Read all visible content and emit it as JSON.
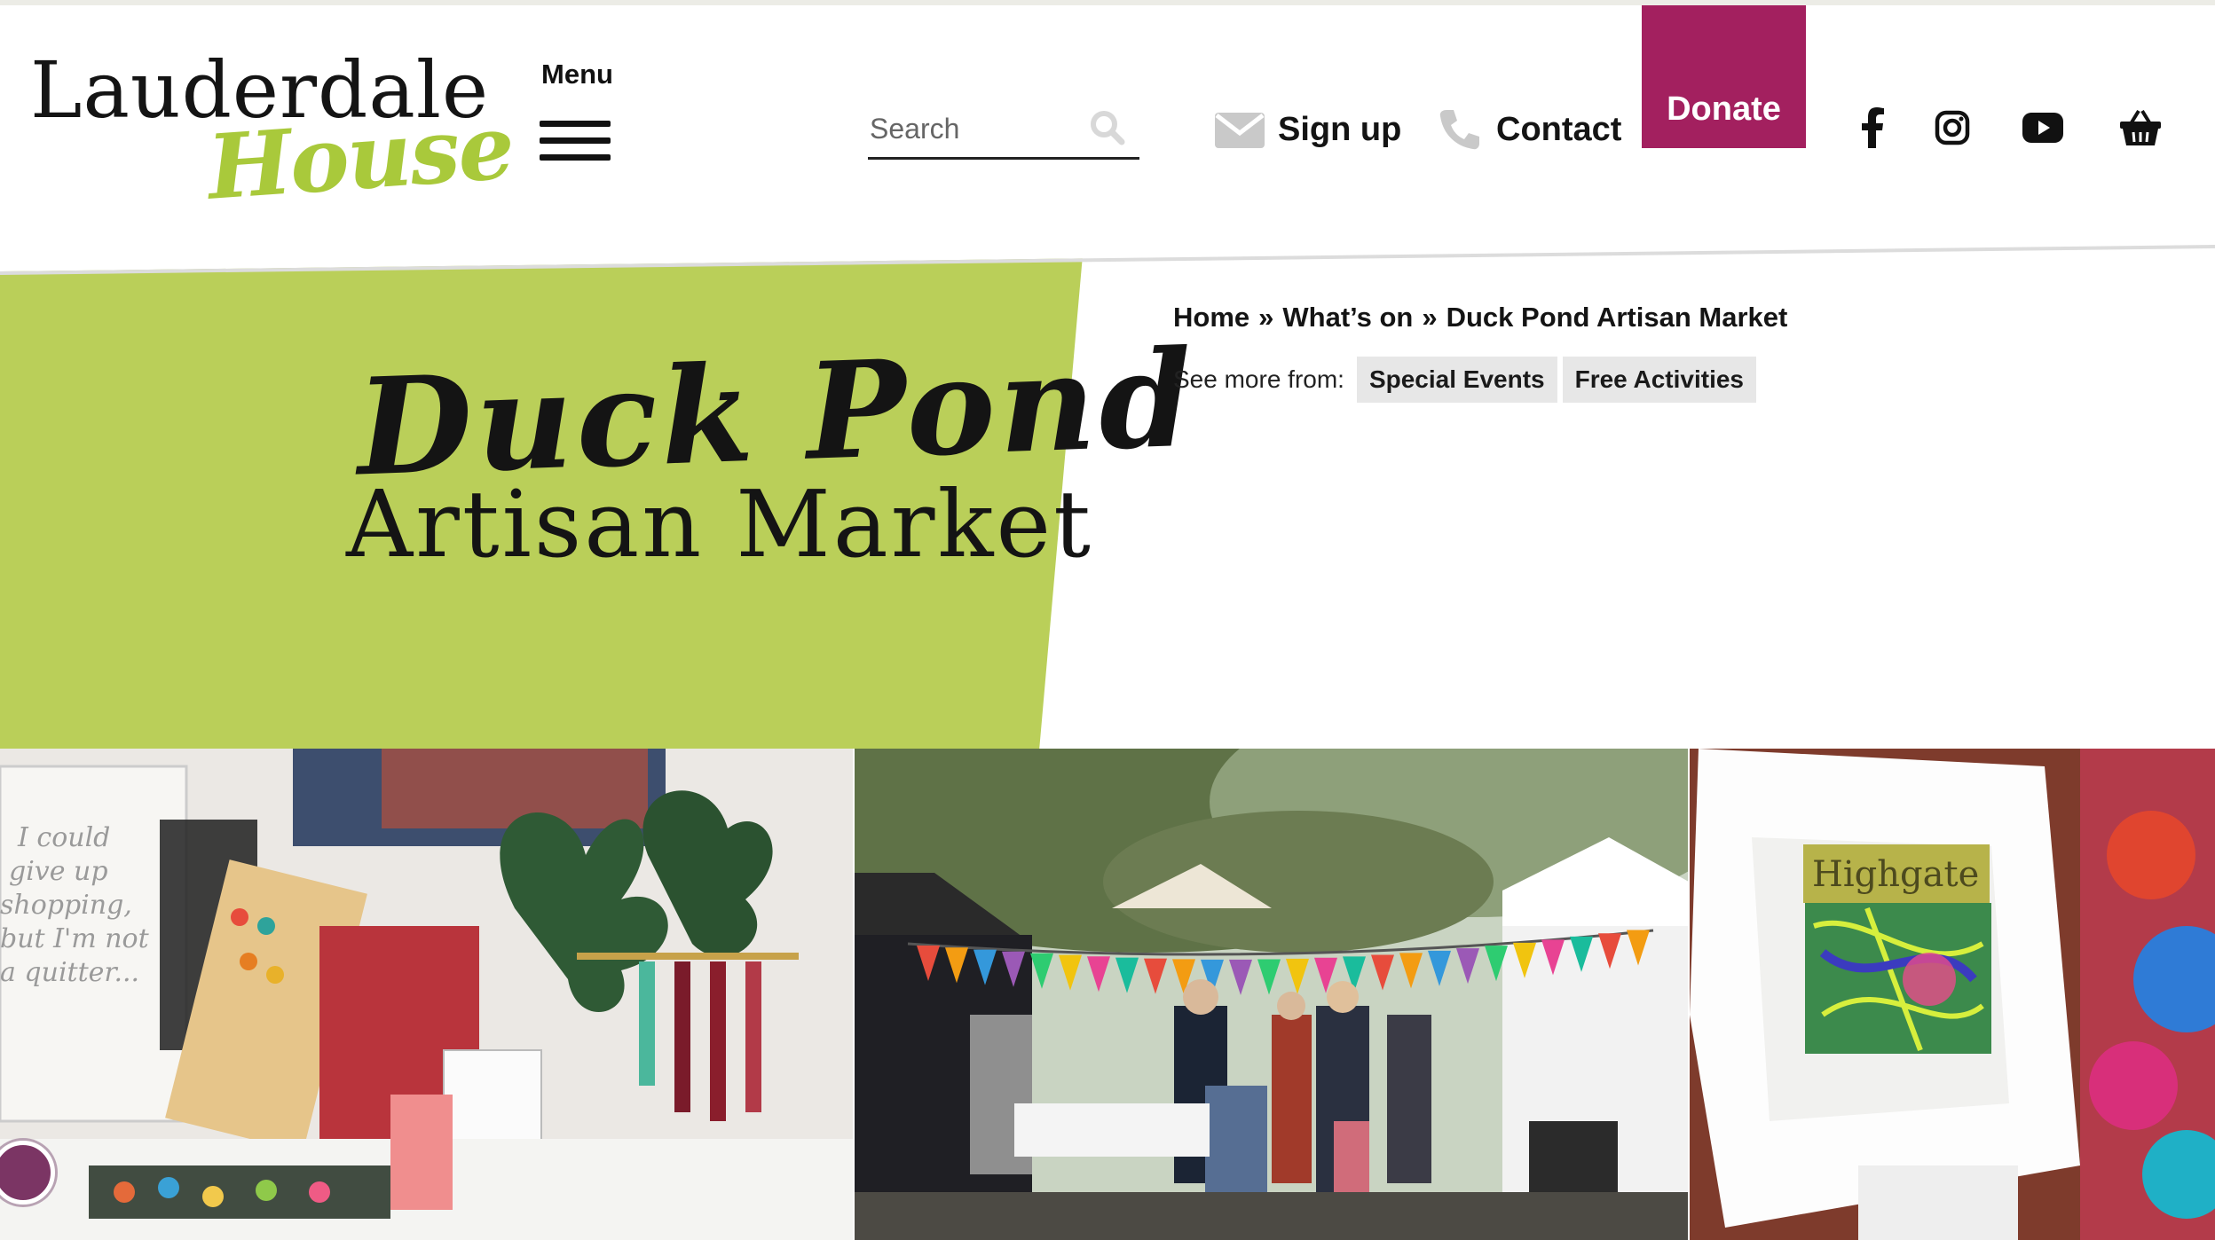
{
  "logo": {
    "line1": "Lauderdale",
    "line2": "House"
  },
  "menu": {
    "label": "Menu"
  },
  "search": {
    "placeholder": "Search"
  },
  "nav": {
    "signup": "Sign up",
    "contact": "Contact",
    "donate": "Donate"
  },
  "social": [
    "facebook-icon",
    "instagram-icon",
    "youtube-icon",
    "basket-icon"
  ],
  "hero": {
    "title_line1": "Duck Pond",
    "title_line2": "Artisan Market"
  },
  "breadcrumb": {
    "home": "Home",
    "sep1": "»",
    "whats_on": "What’s on",
    "sep2": "»",
    "current": "Duck Pond Artisan Market"
  },
  "see_more": {
    "label": "See more from:",
    "tags": [
      "Special Events",
      "Free Activities"
    ]
  },
  "photo_text": {
    "sign": "I could give up shopping, but I'm not a quitter...",
    "print": "Highgate"
  },
  "colors": {
    "accent_green": "#bacf59",
    "donate": "#a3205f",
    "logo_green": "#a9c93b"
  }
}
